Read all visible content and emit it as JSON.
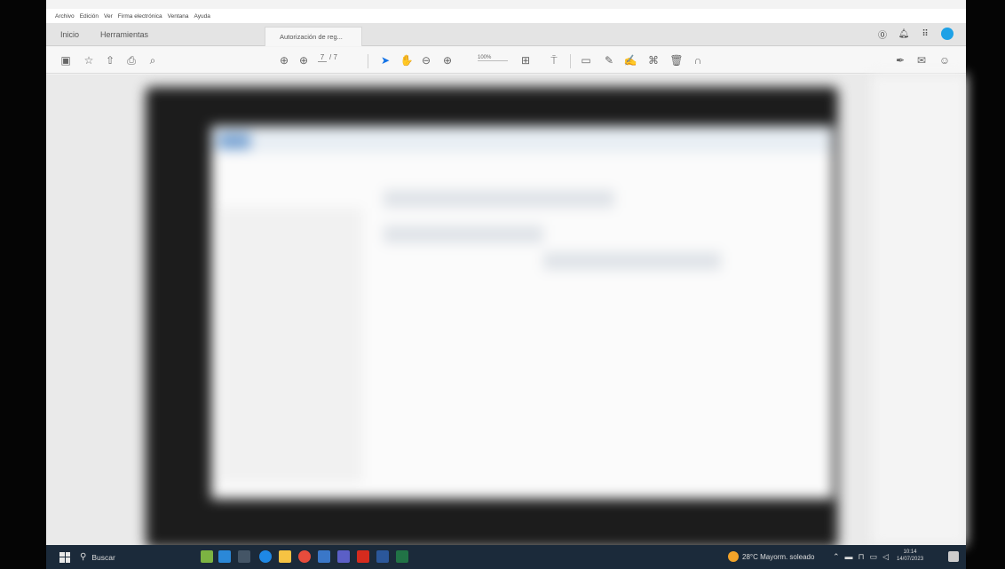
{
  "menu": [
    "Archivo",
    "Edición",
    "Ver",
    "Firma electrónica",
    "Ventana",
    "Ayuda"
  ],
  "tabs": {
    "home": "Inicio",
    "tools": "Herramientas",
    "document": "Autorización de reg..."
  },
  "toolbar": {
    "page_current": "7",
    "page_total": "/ 7",
    "zoom": "100%"
  },
  "taskbar": {
    "search_placeholder": "Buscar",
    "weather": "28°C  Mayorm. soleado",
    "time": "10:14",
    "date": "14/07/2023"
  },
  "colors": {
    "accent": "#1473e6",
    "avatar": "#1ea1e6",
    "taskbar": "#1b2a3a"
  }
}
